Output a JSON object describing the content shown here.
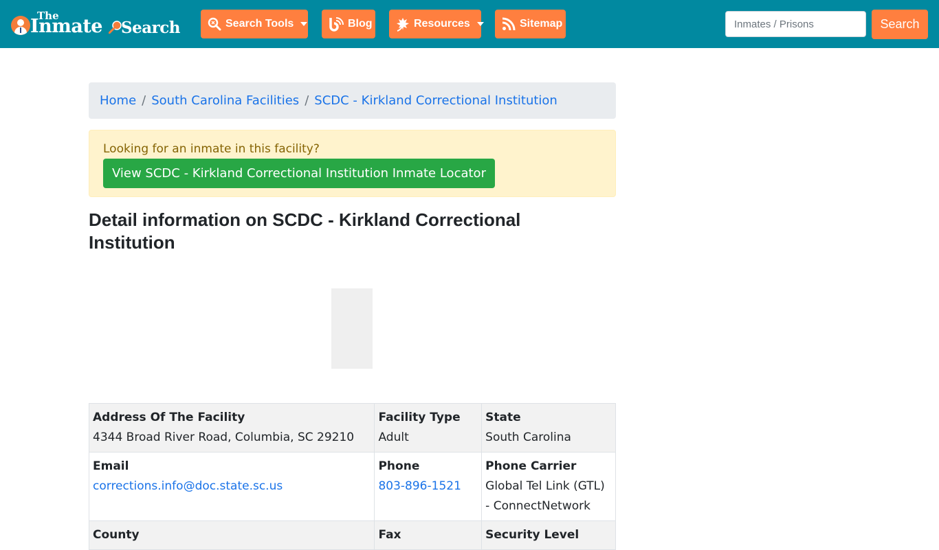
{
  "brand": {
    "logo_the": "The",
    "logo_inmate": "Inmate",
    "logo_search": "Search"
  },
  "nav": {
    "items": [
      {
        "label": "Search Tools",
        "icon": "search-tools-icon",
        "has_dropdown": true
      },
      {
        "label": "Blog",
        "icon": "blog-icon",
        "has_dropdown": false
      },
      {
        "label": "Resources",
        "icon": "leaf-icon",
        "has_dropdown": true
      },
      {
        "label": "Sitemap",
        "icon": "rss-icon",
        "has_dropdown": false
      }
    ],
    "search_placeholder": "Inmates / Prisons",
    "search_value": "",
    "search_button": "Search"
  },
  "breadcrumb": {
    "items": [
      "Home",
      "South Carolina Facilities",
      "SCDC - Kirkland Correctional Institution"
    ],
    "separator": "/"
  },
  "alert": {
    "text": "Looking for an inmate in this facility?",
    "button": "View SCDC - Kirkland Correctional Institution Inmate Locator"
  },
  "page_title": "Detail information on SCDC - Kirkland Correctional Institution",
  "details": {
    "rows": [
      [
        {
          "label": "Address Of The Facility",
          "value": "4344 Broad River Road, Columbia, SC 29210",
          "link": false
        },
        {
          "label": "Facility Type",
          "value": "Adult",
          "link": false
        },
        {
          "label": "State",
          "value": "South Carolina",
          "link": false
        }
      ],
      [
        {
          "label": "Email",
          "value": "corrections.info@doc.state.sc.us",
          "link": true
        },
        {
          "label": "Phone",
          "value": "803-896-1521",
          "link": true
        },
        {
          "label": "Phone Carrier",
          "value": "Global Tel Link (GTL) - ConnectNetwork",
          "link": false
        }
      ],
      [
        {
          "label": "County",
          "value": "",
          "link": false
        },
        {
          "label": "Fax",
          "value": "",
          "link": false
        },
        {
          "label": "Security Level",
          "value": "",
          "link": false
        }
      ]
    ]
  },
  "colors": {
    "navbar": "#0189a0",
    "accent": "#ff7f3f",
    "link": "#1a73e8",
    "success": "#28a745",
    "alert_bg": "#fff3cd"
  }
}
